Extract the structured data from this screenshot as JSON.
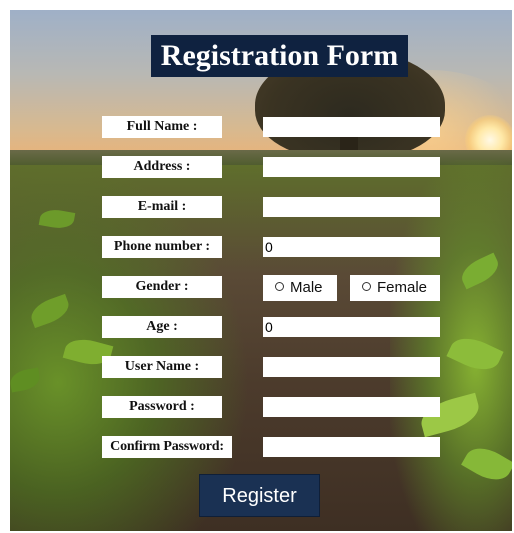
{
  "title": "Registration Form",
  "fields": [
    {
      "label": "Full Name :",
      "value": ""
    },
    {
      "label": "Address :",
      "value": ""
    },
    {
      "label": "E-mail :",
      "value": ""
    },
    {
      "label": "Phone number :",
      "value": "0"
    },
    {
      "label": "Age :",
      "value": "0"
    },
    {
      "label": "User Name :",
      "value": ""
    },
    {
      "label": "Password :",
      "value": ""
    },
    {
      "label": "Confirm Password:",
      "value": ""
    }
  ],
  "gender": {
    "label": "Gender :",
    "options": [
      "Male",
      "Female"
    ]
  },
  "register_label": "Register",
  "colors": {
    "title_bg": "#0f2240",
    "button_bg": "#1a3153",
    "label_bg": "#ffffff"
  }
}
